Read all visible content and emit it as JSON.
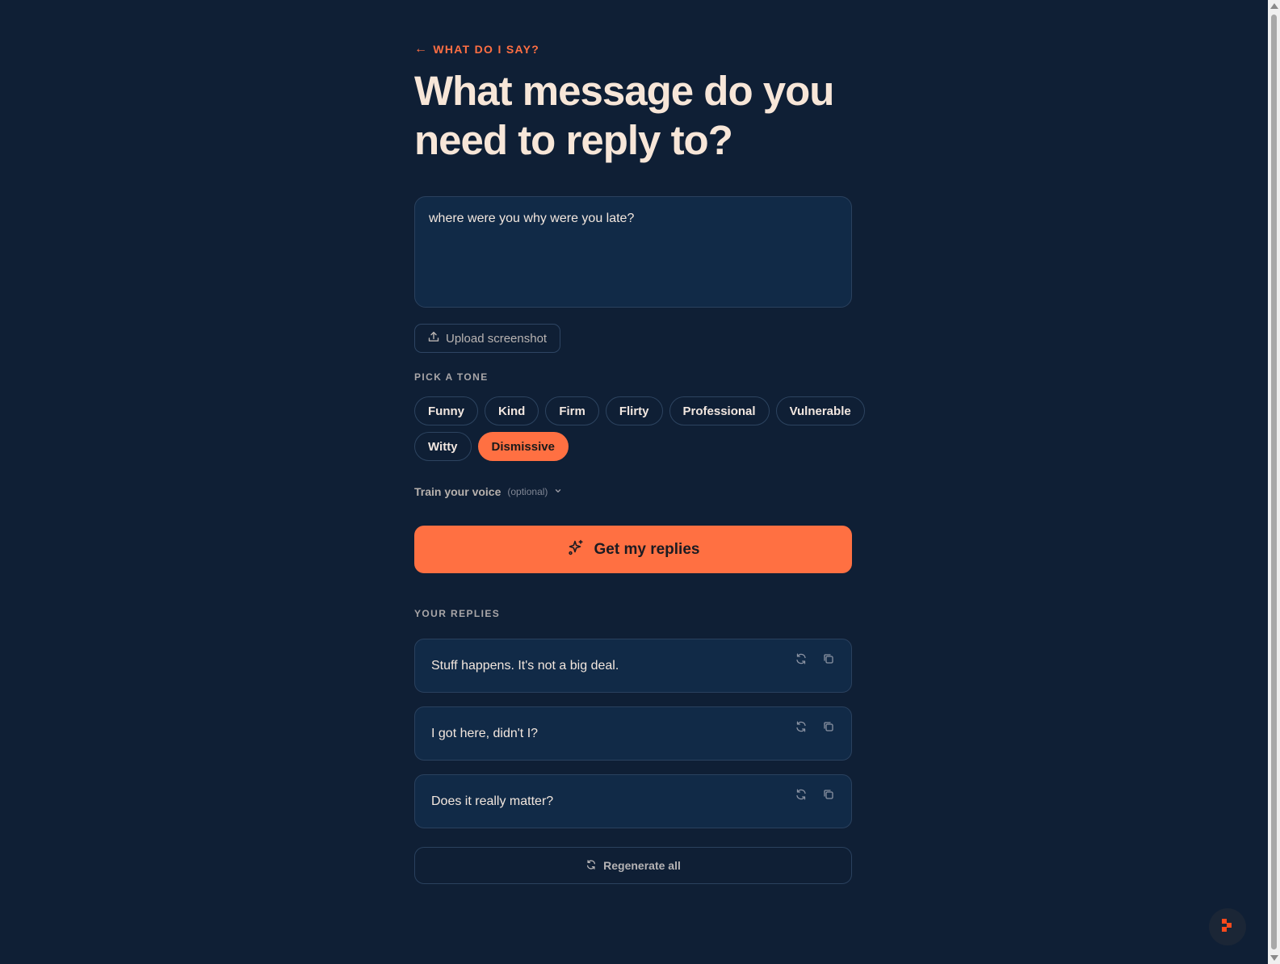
{
  "header": {
    "back_label": "WHAT DO I SAY?",
    "title_line1": "What message do you",
    "title_line2": "need to reply to?"
  },
  "message": {
    "value": "where were you why were you late?"
  },
  "upload": {
    "label": "Upload screenshot"
  },
  "tone": {
    "section_label": "PICK A TONE",
    "options": [
      "Funny",
      "Kind",
      "Firm",
      "Flirty",
      "Professional",
      "Vulnerable",
      "Witty",
      "Dismissive"
    ],
    "selected": "Dismissive"
  },
  "train_voice": {
    "label": "Train your voice",
    "hint": "(optional)"
  },
  "get_replies": {
    "label": "Get my replies"
  },
  "replies": {
    "section_label": "YOUR REPLIES",
    "items": [
      "Stuff happens. It's not a big deal.",
      "I got here, didn't I?",
      "Does it really matter?"
    ],
    "regenerate_all_label": "Regenerate all"
  },
  "colors": {
    "background": "#0f1f35",
    "accent": "#ff7042",
    "card": "#112a47"
  }
}
